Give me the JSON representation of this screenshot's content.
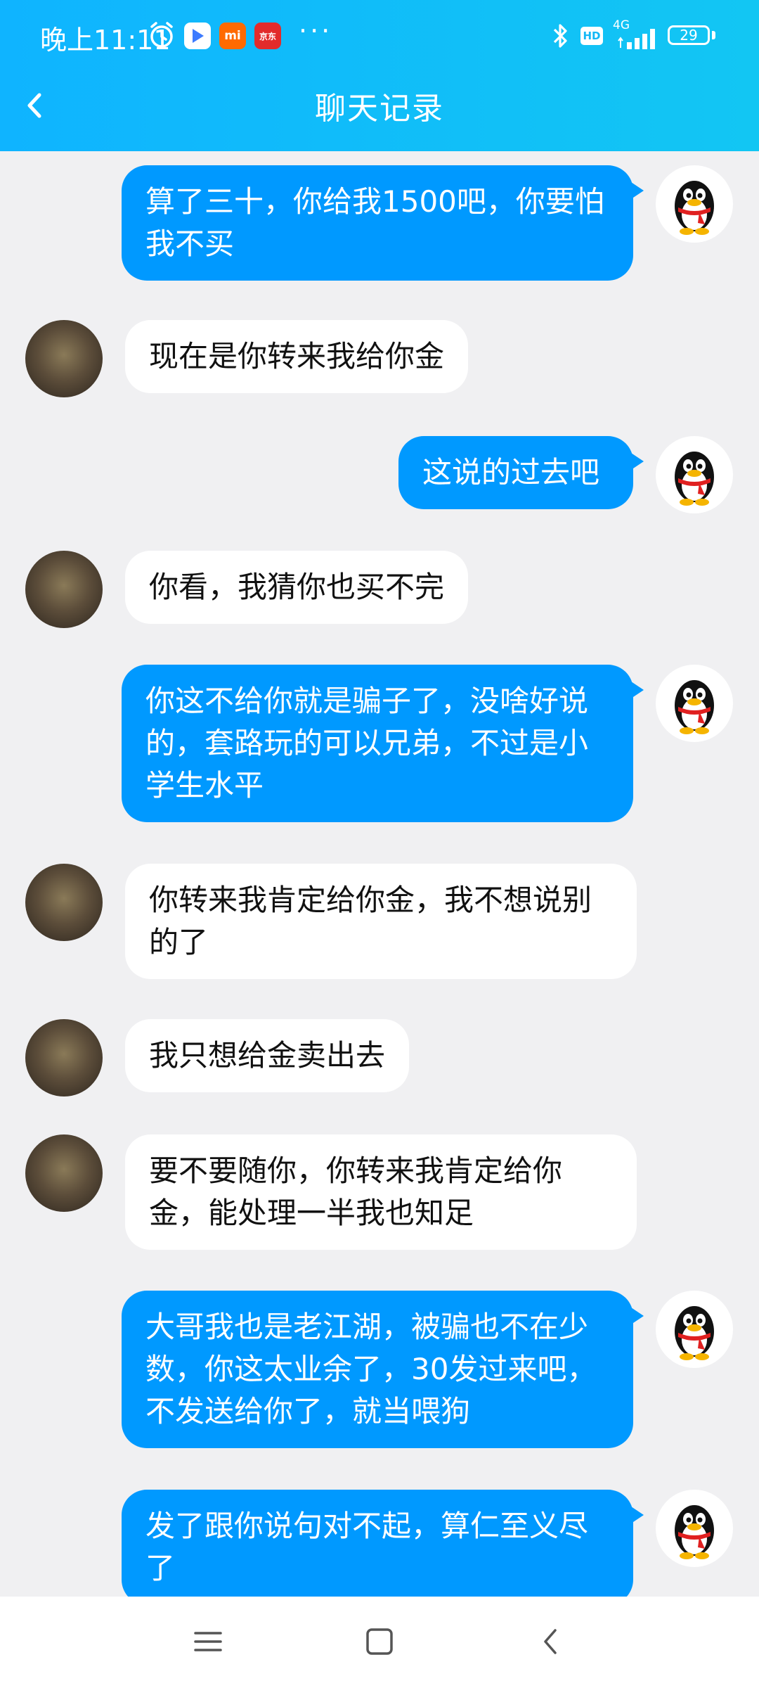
{
  "status": {
    "time": "晚上11:11",
    "app_badge_mi": "mi",
    "app_badge_red": "京东",
    "more": "···",
    "hd": "HD",
    "network": "4G",
    "battery": "29"
  },
  "header": {
    "title": "聊天记录"
  },
  "messages": [
    {
      "side": "right",
      "text": "算了三十，你给我1500吧，你要怕我不买"
    },
    {
      "side": "left",
      "text": "现在是你转来我给你金"
    },
    {
      "side": "right",
      "text": "这说的过去吧"
    },
    {
      "side": "left",
      "text": "你看，我猜你也买不完"
    },
    {
      "side": "right",
      "text": "你这不给你就是骗子了，没啥好说的，套路玩的可以兄弟，不过是小学生水平"
    },
    {
      "side": "left",
      "text": "你转来我肯定给你金，我不想说别的了"
    },
    {
      "side": "left",
      "text": "我只想给金卖出去"
    },
    {
      "side": "left",
      "text": "要不要随你，你转来我肯定给你金，能处理一半我也知足"
    },
    {
      "side": "right",
      "text": "大哥我也是老江湖，被骗也不在少数，你这太业余了，30发过来吧，不发送给你了，就当喂狗"
    },
    {
      "side": "right",
      "text": "发了跟你说句对不起，算仁至义尽了"
    }
  ],
  "icons": {
    "back": "chevron-left-icon",
    "alarm": "alarm-icon",
    "bluetooth": "bluetooth-icon",
    "menu": "menu-icon",
    "home": "home-icon",
    "nav_back": "back-icon"
  },
  "colors": {
    "header": "#12bdf8",
    "bubble_self": "#0099ff",
    "bubble_other": "#ffffff",
    "background": "#f0f0f2"
  }
}
